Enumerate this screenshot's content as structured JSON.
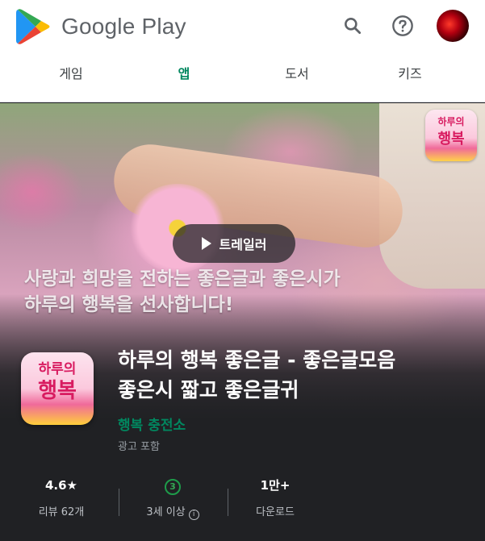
{
  "header": {
    "brand": "Google Play",
    "icons": [
      "search-icon",
      "help-icon",
      "avatar"
    ],
    "tabs": [
      {
        "label": "게임",
        "active": false
      },
      {
        "label": "앱",
        "active": true
      },
      {
        "label": "도서",
        "active": false
      },
      {
        "label": "키즈",
        "active": false
      }
    ],
    "accent_color": "#01875f"
  },
  "hero": {
    "trailer_label": "트레일러",
    "caption_line1": "사랑과 희망을 전하는 좋은글과 좋은시가",
    "caption_line2": "하루의 행복을 선사합니다!",
    "icon_text_top": "하루의",
    "icon_text_bottom": "행복"
  },
  "app": {
    "title_line1": "하루의 행복 좋은글 - 좋은글모음",
    "title_line2": "좋은시 짧고 좋은글귀",
    "developer": "행복 충전소",
    "ads_note": "광고 포함",
    "icon_text_top": "하루의",
    "icon_text_bottom": "행복"
  },
  "stats": {
    "rating": "4.6★",
    "reviews": "리뷰 62개",
    "age_badge": "3",
    "age_label": "3세 이상",
    "downloads": "1만+",
    "downloads_label": "다운로드"
  }
}
